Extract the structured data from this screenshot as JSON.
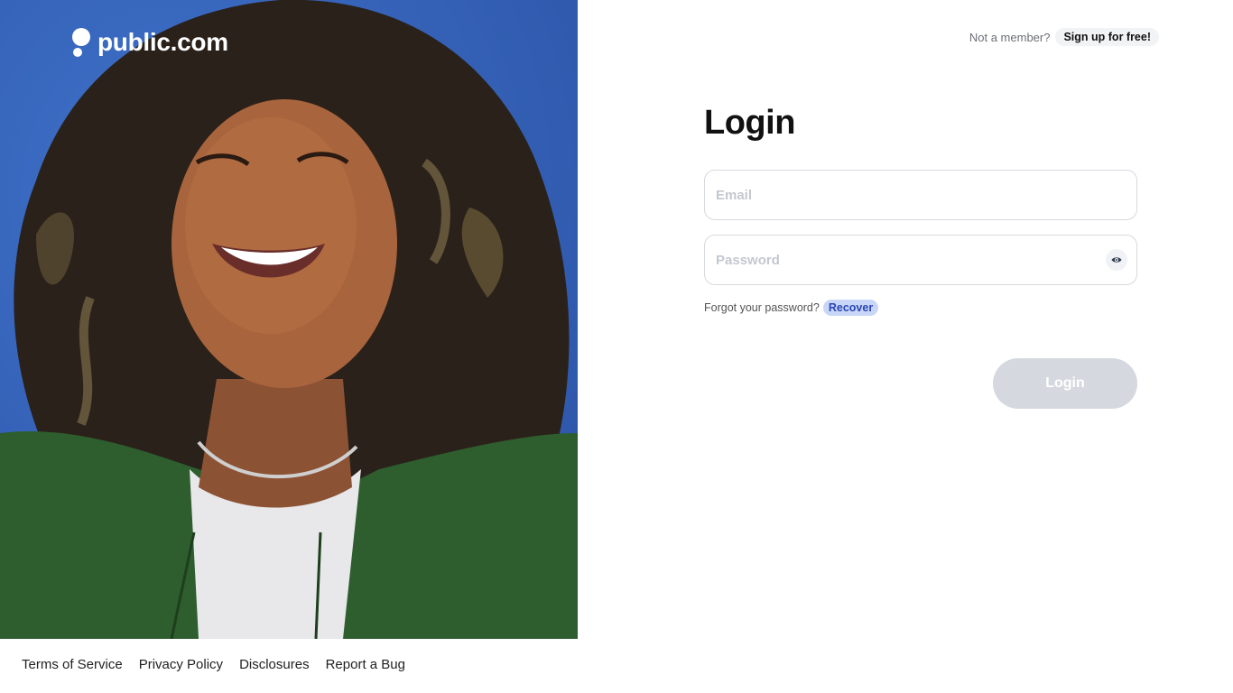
{
  "brand": {
    "name": "public.com"
  },
  "header": {
    "not_member": "Not a member?",
    "signup_label": "Sign up for free!"
  },
  "login": {
    "title": "Login",
    "email_placeholder": "Email",
    "email_value": "",
    "password_placeholder": "Password",
    "password_value": "",
    "forgot_text": "Forgot your password?",
    "recover_label": "Recover",
    "submit_label": "Login"
  },
  "footer": {
    "links": [
      "Terms of Service",
      "Privacy Policy",
      "Disclosures",
      "Report a Bug"
    ]
  },
  "icons": {
    "logo": "public-logo-icon",
    "password_toggle": "eye-icon"
  },
  "colors": {
    "hero_background": "#3563b8",
    "recover_bg": "#c9d6f7",
    "recover_text": "#2a46b3",
    "login_button_disabled": "#d5d9df"
  }
}
